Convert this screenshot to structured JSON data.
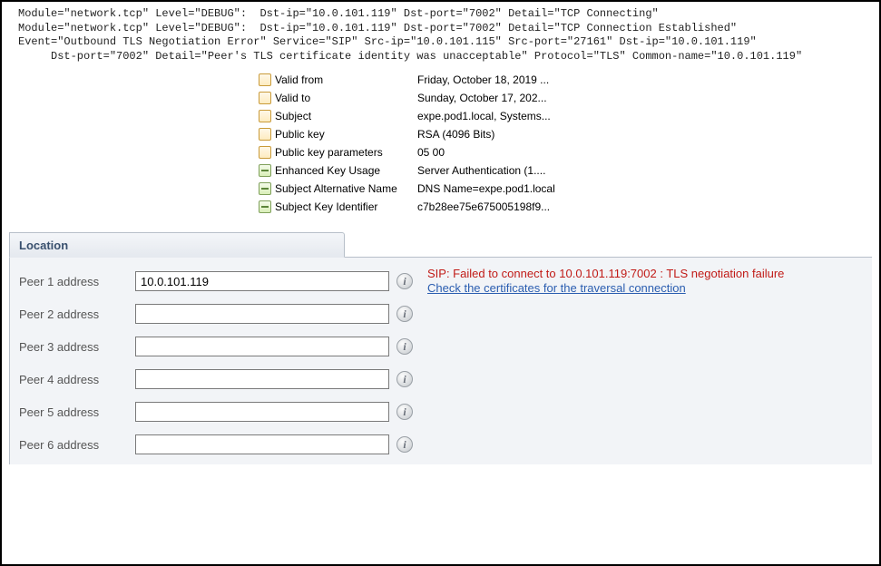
{
  "log": {
    "line1": "Module=\"network.tcp\" Level=\"DEBUG\":  Dst-ip=\"10.0.101.119\" Dst-port=\"7002\" Detail=\"TCP Connecting\"",
    "line2": "Module=\"network.tcp\" Level=\"DEBUG\":  Dst-ip=\"10.0.101.119\" Dst-port=\"7002\" Detail=\"TCP Connection Established\"",
    "line3": "Event=\"Outbound TLS Negotiation Error\" Service=\"SIP\" Src-ip=\"10.0.101.115\" Src-port=\"27161\" Dst-ip=\"10.0.101.119\"",
    "line4": "     Dst-port=\"7002\" Detail=\"Peer's TLS certificate identity was unacceptable\" Protocol=\"TLS\" Common-name=\"10.0.101.119\""
  },
  "cert": {
    "rows": [
      {
        "icon": "prop",
        "key": "Valid from",
        "val": "Friday, October 18, 2019 ..."
      },
      {
        "icon": "prop",
        "key": "Valid to",
        "val": "Sunday, October 17, 202..."
      },
      {
        "icon": "prop",
        "key": "Subject",
        "val": "expe.pod1.local, Systems..."
      },
      {
        "icon": "prop",
        "key": "Public key",
        "val": "RSA (4096 Bits)"
      },
      {
        "icon": "prop",
        "key": "Public key parameters",
        "val": "05 00"
      },
      {
        "icon": "ext",
        "key": "Enhanced Key Usage",
        "val": "Server Authentication (1...."
      },
      {
        "icon": "ext",
        "key": "Subject Alternative Name",
        "val": "DNS Name=expe.pod1.local"
      },
      {
        "icon": "ext",
        "key": "Subject Key Identifier",
        "val": "c7b28ee75e675005198f9..."
      }
    ]
  },
  "section": {
    "title": "Location",
    "peers": [
      {
        "label": "Peer 1 address",
        "value": "10.0.101.119"
      },
      {
        "label": "Peer 2 address",
        "value": ""
      },
      {
        "label": "Peer 3 address",
        "value": ""
      },
      {
        "label": "Peer 4 address",
        "value": ""
      },
      {
        "label": "Peer 5 address",
        "value": ""
      },
      {
        "label": "Peer 6 address",
        "value": ""
      }
    ],
    "error": {
      "text": "SIP: Failed to connect to 10.0.101.119:7002 : TLS negotiation failure",
      "link": "Check the certificates for the traversal connection"
    }
  }
}
